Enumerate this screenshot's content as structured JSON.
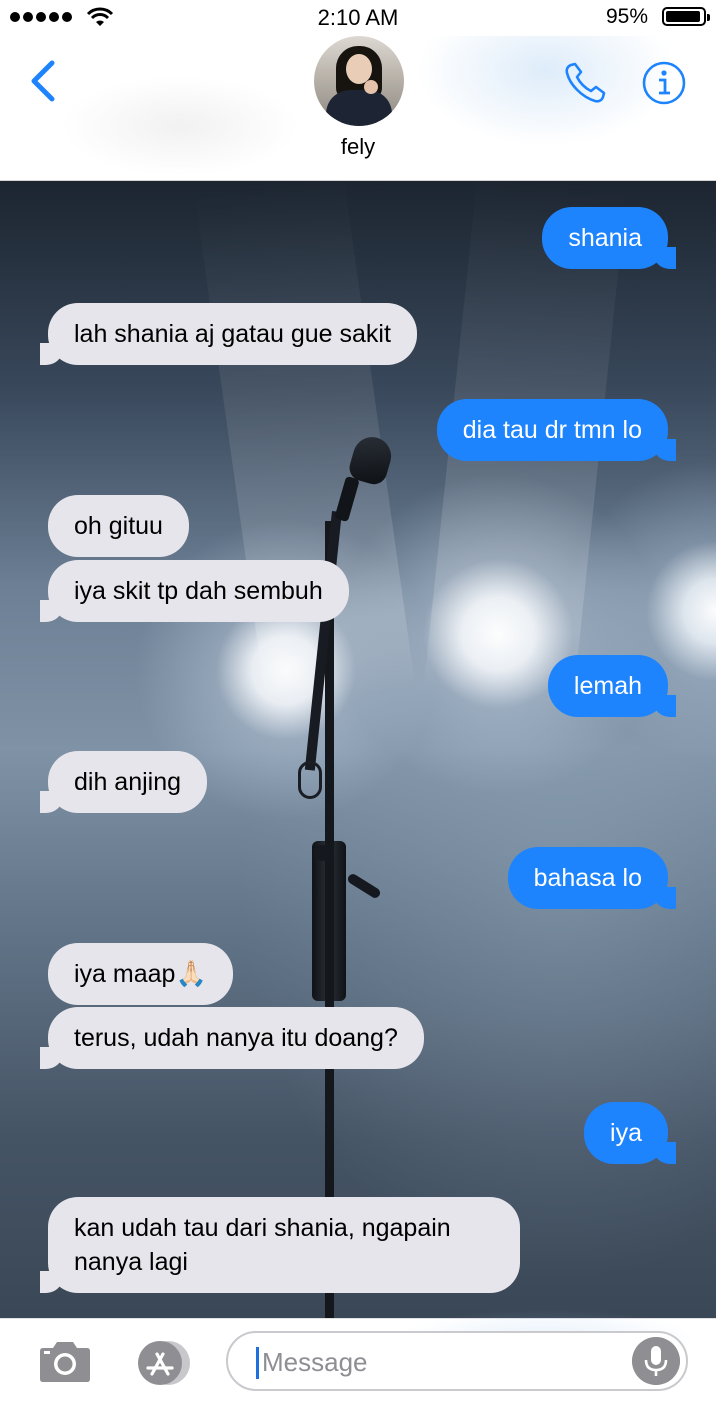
{
  "status_bar": {
    "time": "2:10 AM",
    "battery_percent": "95%",
    "signal_bars": 5,
    "battery_level": 0.95
  },
  "header": {
    "contact_name": "fely",
    "back_icon": "chevron-left-icon",
    "call_icon": "phone-icon",
    "info_icon": "info-icon"
  },
  "messages": [
    {
      "direction": "out",
      "text": "shania"
    },
    {
      "direction": "in",
      "text": "lah shania aj gatau gue sakit"
    },
    {
      "direction": "out",
      "text": "dia tau dr tmn lo"
    },
    {
      "direction": "in",
      "text": "oh gituu"
    },
    {
      "direction": "in",
      "text": "iya skit tp dah sembuh"
    },
    {
      "direction": "out",
      "text": "lemah"
    },
    {
      "direction": "in",
      "text": "dih anjing"
    },
    {
      "direction": "out",
      "text": "bahasa lo"
    },
    {
      "direction": "in",
      "text": "iya maap🙏🏻"
    },
    {
      "direction": "in",
      "text": "terus, udah nanya itu doang?"
    },
    {
      "direction": "out",
      "text": "iya"
    },
    {
      "direction": "in",
      "text": "kan udah tau dari shania, ngapain nanya lagi"
    }
  ],
  "input_bar": {
    "placeholder": "Message",
    "value": "",
    "camera_icon": "camera-icon",
    "apps_icon": "app-store-icon",
    "mic_icon": "microphone-icon"
  },
  "colors": {
    "accent": "#1e84fd",
    "incoming_bubble": "#e6e5eb",
    "outgoing_bubble": "#1e84fd"
  }
}
